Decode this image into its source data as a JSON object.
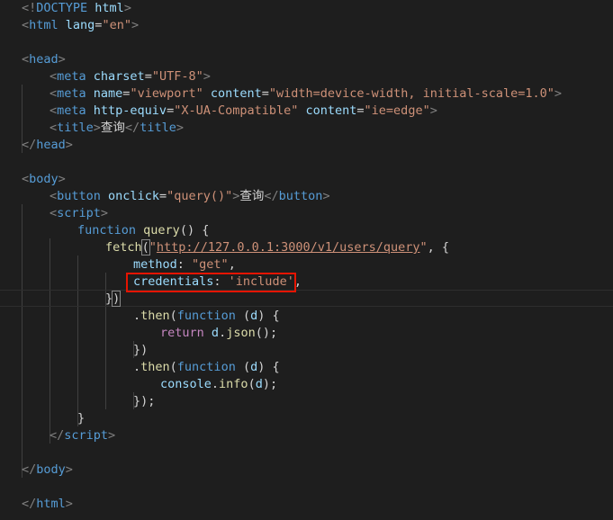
{
  "editor": {
    "colors": {
      "background": "#1e1e1e",
      "tag": "#569cd6",
      "attribute": "#9cdcfe",
      "string": "#ce9178",
      "function": "#dcdcaa",
      "keyword_control": "#c586c0",
      "highlight_box": "#e51400"
    },
    "lines": {
      "l0": {
        "a": "<!",
        "b": "DOCTYPE",
        "c": " html",
        "d": ">"
      },
      "l1": {
        "a": "<",
        "b": "html",
        "c": " lang",
        "d": "=",
        "e": "\"en\"",
        "f": ">"
      },
      "l3": {
        "a": "<",
        "b": "head",
        "c": ">"
      },
      "l4": {
        "a": "<",
        "b": "meta",
        "c": " charset",
        "d": "=",
        "e": "\"UTF-8\"",
        "f": ">"
      },
      "l5": {
        "a": "<",
        "b": "meta",
        "c": " name",
        "d": "=",
        "e": "\"viewport\"",
        "f": " content",
        "g": "=",
        "h": "\"width=device-width, initial-scale=1.0\"",
        "i": ">"
      },
      "l6": {
        "a": "<",
        "b": "meta",
        "c": " http-equiv",
        "d": "=",
        "e": "\"X-UA-Compatible\"",
        "f": " content",
        "g": "=",
        "h": "\"ie=edge\"",
        "i": ">"
      },
      "l7": {
        "a": "<",
        "b": "title",
        "c": ">",
        "d": "查询",
        "e": "</",
        "f": "title",
        "g": ">"
      },
      "l8": {
        "a": "</",
        "b": "head",
        "c": ">"
      },
      "l10": {
        "a": "<",
        "b": "body",
        "c": ">"
      },
      "l11": {
        "a": "<",
        "b": "button",
        "c": " onclick",
        "d": "=",
        "e": "\"query()\"",
        "f": ">",
        "g": "查询",
        "h": "</",
        "i": "button",
        "j": ">"
      },
      "l12": {
        "a": "<",
        "b": "script",
        "c": ">"
      },
      "l13": {
        "a": "function",
        "b": " ",
        "c": "query",
        "d": "() {"
      },
      "l14": {
        "a": "fetch",
        "b": "(",
        "c": "\"",
        "d": "http://127.0.0.1:3000/v1/users/query",
        "e": "\"",
        "f": ", {"
      },
      "l15": {
        "a": "method",
        "b": ": ",
        "c": "\"get\"",
        "d": ","
      },
      "l16": {
        "a": "credentials",
        "b": ": ",
        "c": "'include'",
        "d": ","
      },
      "l17": {
        "a": "}",
        "b": ")"
      },
      "l18": {
        "a": ".",
        "b": "then",
        "c": "(",
        "d": "function",
        "e": " (",
        "f": "d",
        "g": ") {"
      },
      "l19": {
        "a": "return",
        "b": " ",
        "c": "d",
        "d": ".",
        "e": "json",
        "f": "();"
      },
      "l20": {
        "a": "})"
      },
      "l21": {
        "a": ".",
        "b": "then",
        "c": "(",
        "d": "function",
        "e": " (",
        "f": "d",
        "g": ") {"
      },
      "l22": {
        "a": "console",
        "b": ".",
        "c": "info",
        "d": "(",
        "e": "d",
        "f": ");"
      },
      "l23": {
        "a": "});"
      },
      "l24": {
        "a": "}"
      },
      "l25": {
        "a": "</",
        "b": "script",
        "c": ">"
      },
      "l27": {
        "a": "</",
        "b": "body",
        "c": ">"
      },
      "l29": {
        "a": "</",
        "b": "html",
        "c": ">"
      }
    }
  }
}
